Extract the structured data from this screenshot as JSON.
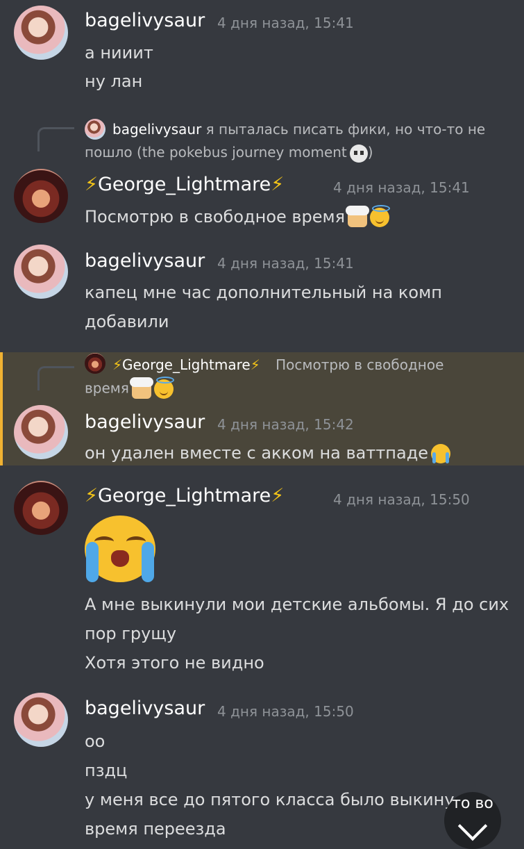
{
  "messages": [
    {
      "author": "bagelivysaur",
      "timestamp": "4 дня назад, 15:41",
      "lines": [
        "а нииит",
        "ну лан"
      ]
    },
    {
      "reply": {
        "author": "bagelivysaur",
        "text_line1": "я пыталась писать фики, но что-то не",
        "text_line2": "пошло (the pokebus journey moment"
      },
      "author": "George_Lightmare",
      "timestamp": "4 дня назад, 15:41",
      "lines": [
        "Посмотрю в свободное время"
      ]
    },
    {
      "author": "bagelivysaur",
      "timestamp": "4 дня назад, 15:41",
      "lines": [
        "капец мне час дополнительный на комп",
        "добавили"
      ]
    },
    {
      "reply": {
        "author": "George_Lightmare",
        "text_line1": "Посмотрю в свободное",
        "text_line2": "время"
      },
      "author": "bagelivysaur",
      "timestamp": "4 дня назад, 15:42",
      "lines": [
        "он удален вместе с акком на ваттпаде"
      ],
      "highlighted": true
    },
    {
      "author": "George_Lightmare",
      "timestamp": "4 дня назад, 15:50",
      "lines": [
        "А мне выкинули мои детские альбомы. Я до сих",
        "пор грущу",
        "Хотя этого не видно"
      ]
    },
    {
      "author": "bagelivysaur",
      "timestamp": "4 дня назад, 15:50",
      "lines": [
        "оо",
        "пздц",
        "у меня все до пятого класса было выкину",
        "время переезда"
      ]
    }
  ],
  "scroll_button": {
    "label": "то во"
  },
  "bolt_symbol": "⚡",
  "colors": {
    "background": "#36393f",
    "highlight": "#4a463a",
    "highlight_border": "#f0b232"
  }
}
